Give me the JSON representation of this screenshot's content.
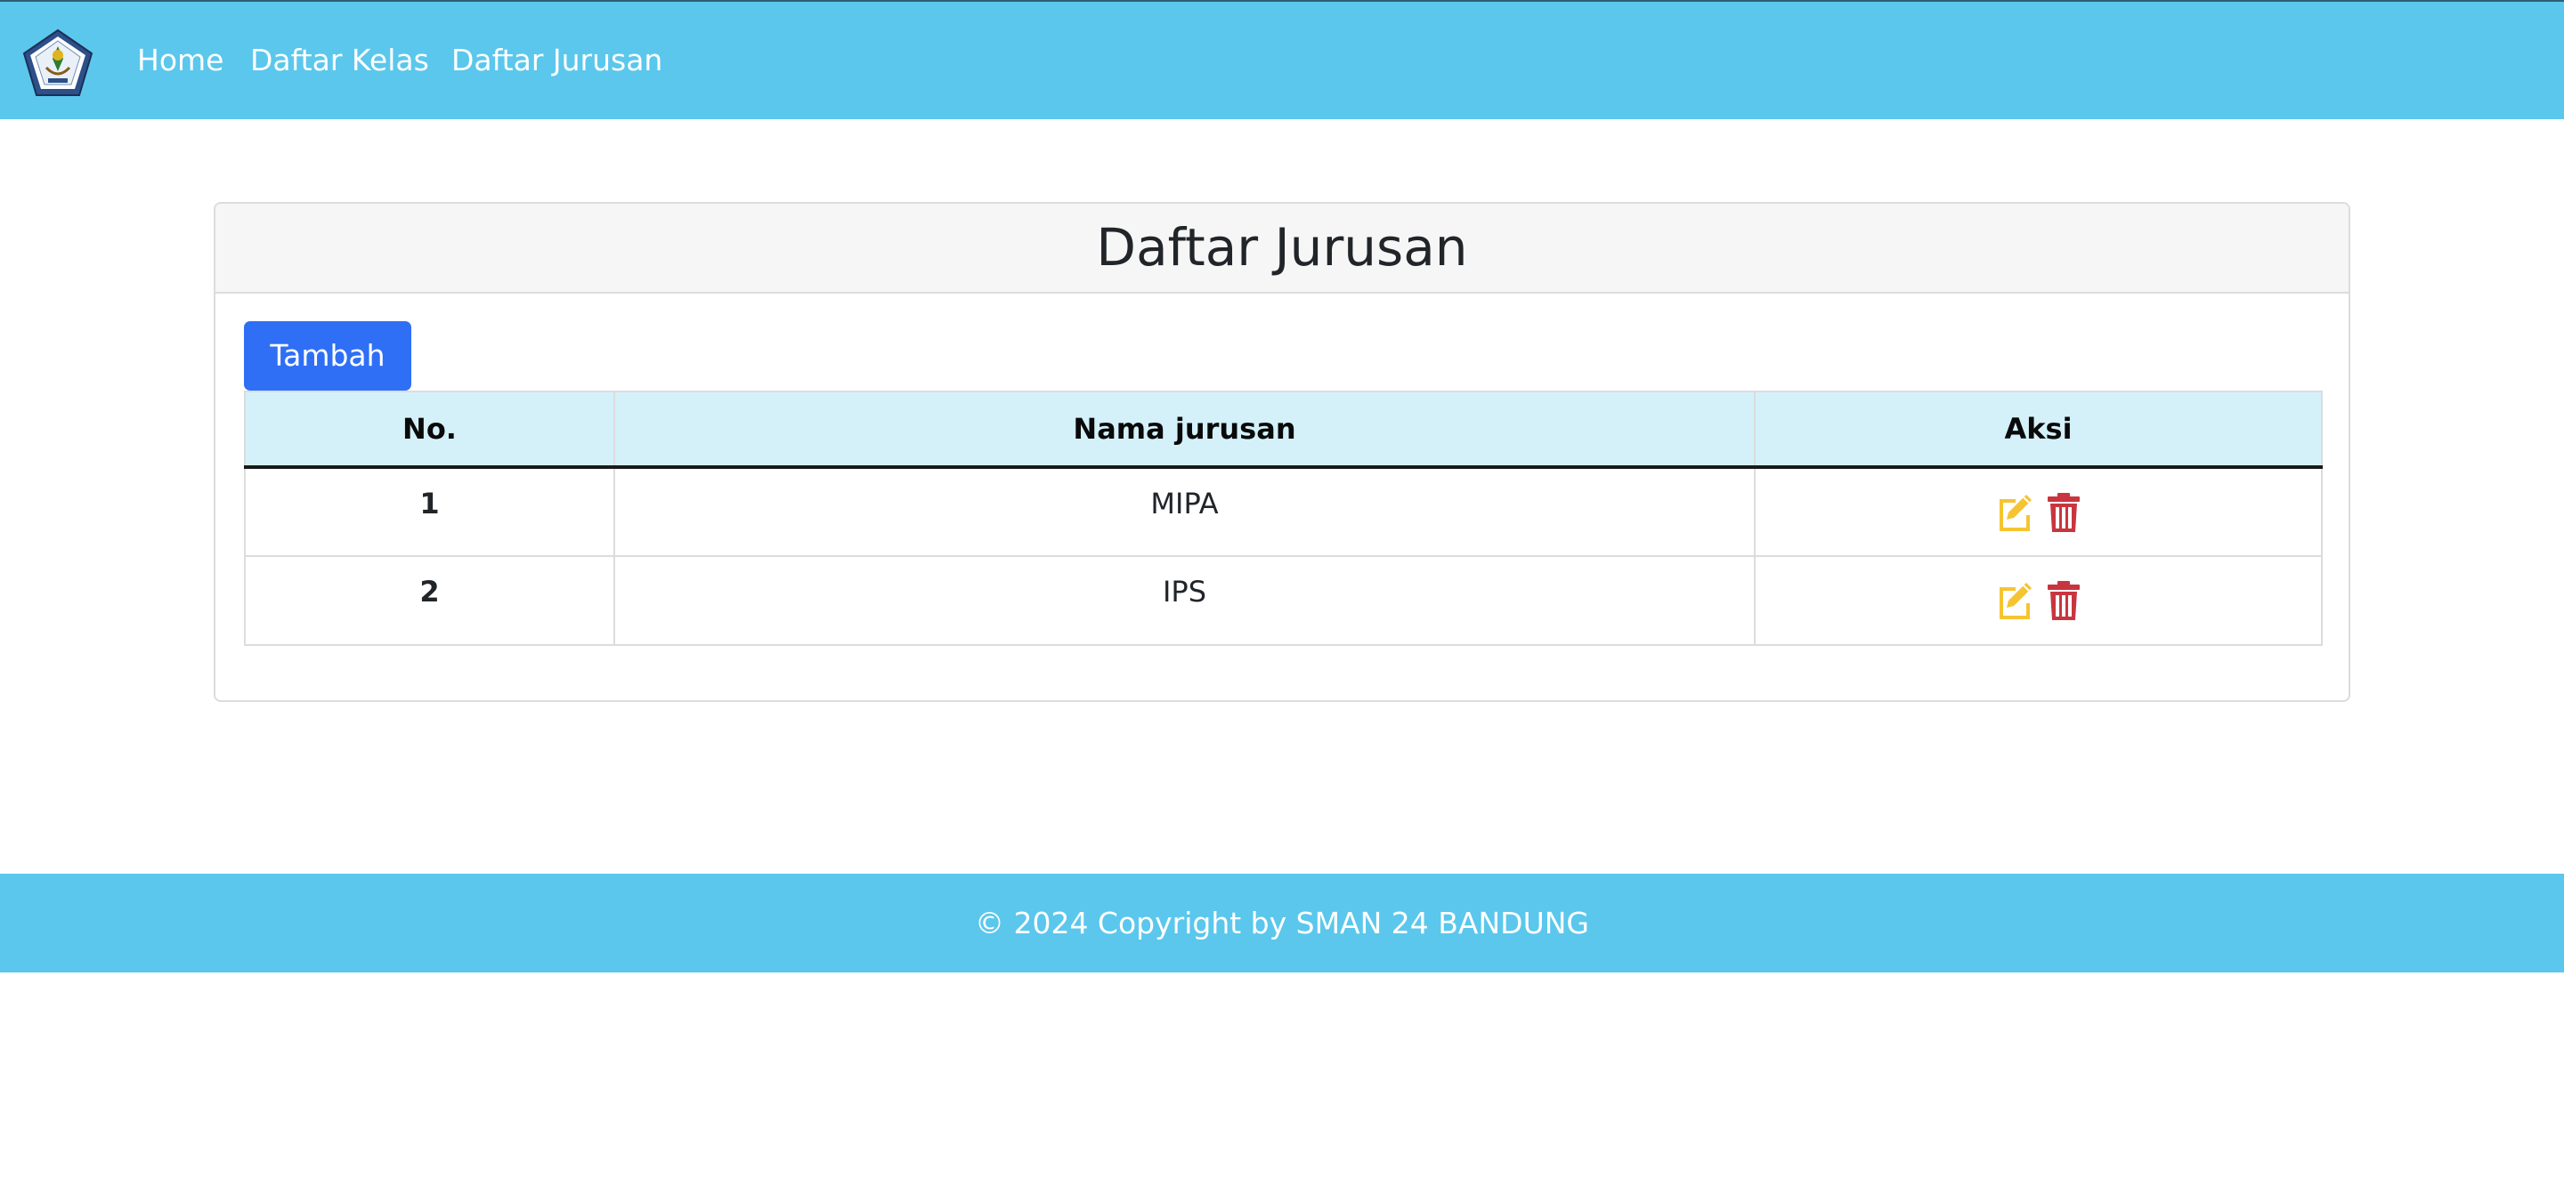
{
  "navbar": {
    "logo_icon": "school-crest-logo",
    "links": [
      {
        "label": "Home"
      },
      {
        "label": "Daftar Kelas"
      },
      {
        "label": "Daftar Jurusan"
      }
    ],
    "background": "#5bc7ec"
  },
  "card": {
    "title": "Daftar Jurusan",
    "add_button_label": "Tambah",
    "add_button_color": "#2f6ff6"
  },
  "table": {
    "headers": [
      "No.",
      "Nama jurusan",
      "Aksi"
    ],
    "rows": [
      {
        "no": "1",
        "name": "MIPA",
        "actions": [
          "edit-icon",
          "delete-icon"
        ]
      },
      {
        "no": "2",
        "name": "IPS",
        "actions": [
          "edit-icon",
          "delete-icon"
        ]
      }
    ],
    "edit_color": "#f5c431",
    "delete_color": "#c9353f"
  },
  "footer": {
    "text": "© 2024 Copyright by SMAN 24 BANDUNG"
  }
}
